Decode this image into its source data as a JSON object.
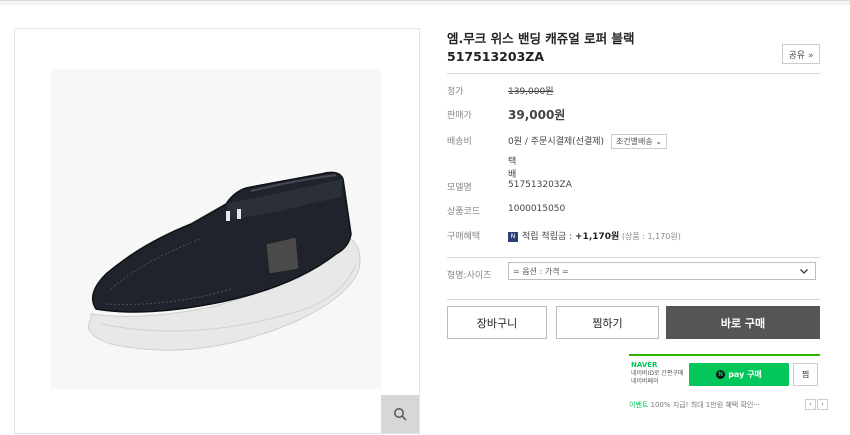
{
  "product": {
    "title": "엠.무크 위스 밴딩 캐쥬얼 로퍼 블랙",
    "code": "517513203ZA",
    "share_label": "공유 »"
  },
  "price": {
    "list_label": "정가",
    "list_value": "139,000원",
    "sale_label": "판매가",
    "sale_value": "39,000원"
  },
  "shipping": {
    "label": "배송비",
    "value": "0원  / 주문시결제(선결제)",
    "condition_dropdown": "조건별배송 ⌄",
    "method": "택배"
  },
  "details": {
    "model_label": "모델명",
    "model_value": "517513203ZA",
    "code_label": "상품코드",
    "code_value": "1000015050",
    "benefit_label": "구매혜택",
    "benefit_badge": "N",
    "benefit_text": "적립 적립금 : ",
    "benefit_amount": "+1,170원",
    "benefit_note": " (상품 : 1,170원)"
  },
  "option": {
    "label": "형명:사이즈",
    "select_value": "= 옵션 : 가격 ="
  },
  "buttons": {
    "cart": "장바구니",
    "wish": "찜하기",
    "buy": "바로 구매"
  },
  "naver": {
    "logo": "NAVER",
    "desc_line1": "네이버ID로 간편구매",
    "desc_line2": "네이버페이",
    "pay_icon": "N",
    "pay_label": "pay 구매",
    "wish_label": "찜",
    "event_label": "이벤트",
    "event_text": " 100% 지급! 최대 1만원 혜택 확인···",
    "prev": "‹",
    "next": "›"
  },
  "icons": {
    "zoom": "magnifier-icon",
    "select_arrow": "chevron-down-icon"
  },
  "colors": {
    "buy_button": "#555555",
    "naver_green": "#03c75a"
  }
}
